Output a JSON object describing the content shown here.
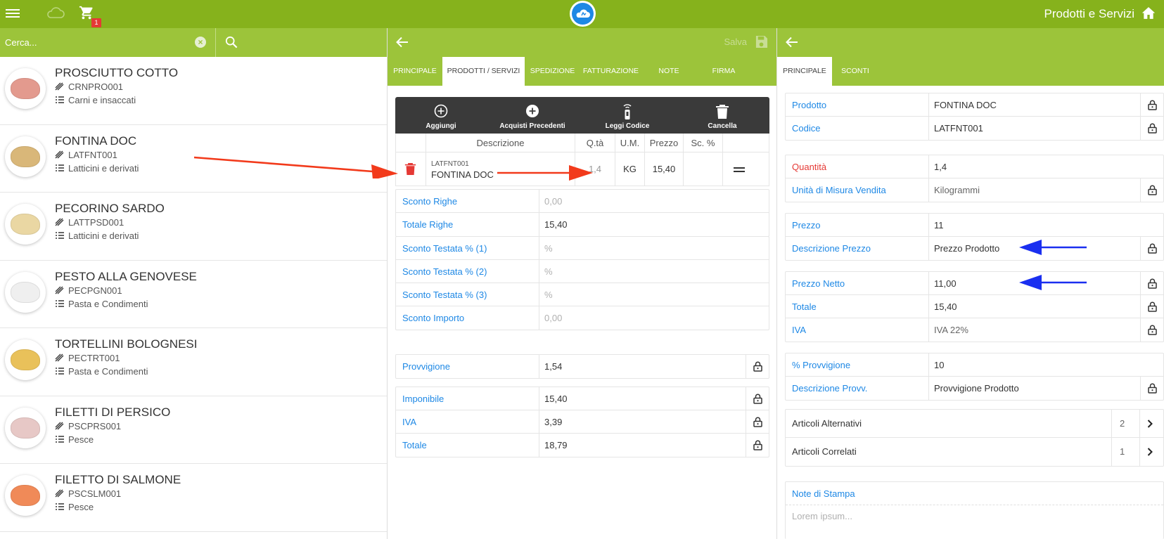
{
  "topbar": {
    "title": "Prodotti e Servizi",
    "cart_count": "1"
  },
  "search": {
    "placeholder": "Cerca..."
  },
  "products": [
    {
      "name": "PROSCIUTTO COTTO",
      "code": "CRNPRO001",
      "category": "Carni e insaccati",
      "color": "#e39a8e"
    },
    {
      "name": "FONTINA DOC",
      "code": "LATFNT001",
      "category": "Latticini e derivati",
      "color": "#d9b779"
    },
    {
      "name": "PECORINO SARDO",
      "code": "LATTPSD001",
      "category": "Latticini e derivati",
      "color": "#ead7a3"
    },
    {
      "name": "PESTO ALLA GENOVESE",
      "code": "PECPGN001",
      "category": "Pasta e Condimenti",
      "color": "#efefef"
    },
    {
      "name": "TORTELLINI BOLOGNESI",
      "code": "PECTRT001",
      "category": "Pasta e Condimenti",
      "color": "#e9c15a"
    },
    {
      "name": "FILETTI DI PERSICO",
      "code": "PSCPRS001",
      "category": "Pesce",
      "color": "#e7c8c6"
    },
    {
      "name": "FILETTO DI SALMONE",
      "code": "PSCSLM001",
      "category": "Pesce",
      "color": "#f08a58"
    }
  ],
  "middle": {
    "save_label": "Salva",
    "tabs": [
      "PRINCIPALE",
      "PRODOTTI / SERVIZI",
      "SPEDIZIONE",
      "FATTURAZIONE",
      "NOTE",
      "FIRMA"
    ],
    "toolbar": [
      "Aggiungi",
      "Acquisti Precedenti",
      "Leggi Codice",
      "Cancella"
    ],
    "grid_headers": {
      "desc": "Descrizione",
      "qty": "Q.tà",
      "um": "U.M.",
      "price": "Prezzo",
      "disc": "Sc. %"
    },
    "row": {
      "code": "LATFNT001",
      "desc": "FONTINA DOC",
      "qty": "1,4",
      "um": "KG",
      "price": "15,40",
      "disc": ""
    },
    "totals": [
      {
        "label": "Sconto Righe",
        "value": "0,00"
      },
      {
        "label": "Totale Righe",
        "value": "15,40"
      }
    ],
    "discounts": [
      {
        "label": "Sconto Testata % (1)",
        "value": "%"
      },
      {
        "label": "Sconto Testata % (2)",
        "value": "%"
      },
      {
        "label": "Sconto Testata % (3)",
        "value": "%"
      },
      {
        "label": "Sconto Importo",
        "value": "0,00"
      }
    ],
    "commission": {
      "label": "Provvigione",
      "value": "1,54"
    },
    "summary": [
      {
        "label": "Imponibile",
        "value": "15,40"
      },
      {
        "label": "IVA",
        "value": "3,39"
      },
      {
        "label": "Totale",
        "value": "18,79"
      }
    ]
  },
  "right": {
    "tabs": [
      "PRINCIPALE",
      "SCONTI"
    ],
    "product": [
      {
        "label": "Prodotto",
        "value": "FONTINA DOC"
      },
      {
        "label": "Codice",
        "value": "LATFNT001"
      }
    ],
    "quantity": [
      {
        "label": "Quantità",
        "value": "1,4"
      },
      {
        "label": "Unità di Misura Vendita",
        "value": "Kilogrammi"
      }
    ],
    "price": [
      {
        "label": "Prezzo",
        "value": "11"
      },
      {
        "label": "Descrizione Prezzo",
        "value": "Prezzo Prodotto"
      }
    ],
    "net": [
      {
        "label": "Prezzo Netto",
        "value": "11,00"
      },
      {
        "label": "Totale",
        "value": "15,40"
      },
      {
        "label": "IVA",
        "value": "IVA 22%"
      }
    ],
    "commission": [
      {
        "label": "% Provvigione",
        "value": "10"
      },
      {
        "label": "Descrizione Provv.",
        "value": "Provvigione Prodotto"
      }
    ],
    "articles": [
      {
        "label": "Articoli Alternativi",
        "count": "2"
      },
      {
        "label": "Articoli Correlati",
        "count": "1"
      }
    ],
    "notes": {
      "label": "Note di Stampa",
      "placeholder": "Lorem ipsum..."
    }
  },
  "colors": {
    "brand": "#86b21c",
    "bar": "#9cc43a",
    "link": "#1e88e5",
    "alert": "#e53935",
    "annotation_blue": "#1a2ff0"
  }
}
